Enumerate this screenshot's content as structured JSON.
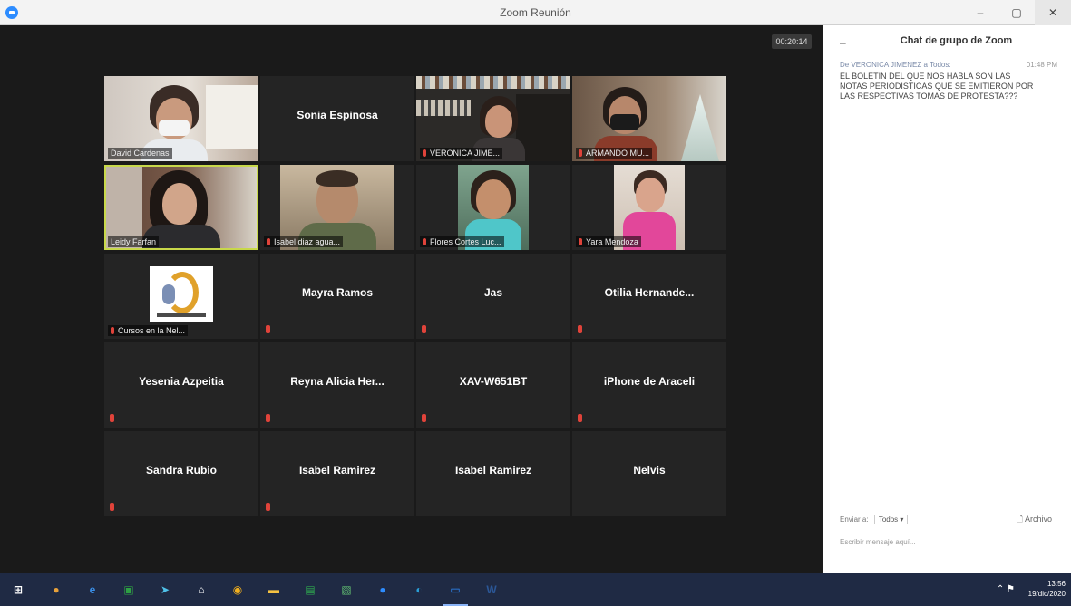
{
  "window": {
    "title": "Zoom Reunión",
    "controls": [
      "–",
      "▢",
      "✕"
    ]
  },
  "meeting": {
    "timer": "00:20:14",
    "tiles": [
      {
        "id": "david",
        "type": "video",
        "label": "David Cardenas",
        "muted": false,
        "active": false
      },
      {
        "id": "sonia",
        "type": "name",
        "name": "Sonia Espinosa",
        "muted": false,
        "active": false
      },
      {
        "id": "veronica",
        "type": "video",
        "label": "VERONICA JIME...",
        "muted": true,
        "active": false
      },
      {
        "id": "armando",
        "type": "video",
        "label": "ARMANDO MU...",
        "muted": true,
        "active": false
      },
      {
        "id": "leidy",
        "type": "video",
        "label": "Leidy Farfan",
        "muted": false,
        "active": true
      },
      {
        "id": "isabel-diaz",
        "type": "video",
        "label": "Isabel diaz agua...",
        "muted": true,
        "active": false
      },
      {
        "id": "flores",
        "type": "video",
        "label": "Flores Cortes Luc...",
        "muted": true,
        "active": false
      },
      {
        "id": "yara",
        "type": "video",
        "label": "Yara Mendoza",
        "muted": true,
        "active": false
      },
      {
        "id": "cursos",
        "type": "logo",
        "label": "Cursos en la Nel...",
        "muted": true,
        "active": false
      },
      {
        "id": "mayra",
        "type": "name",
        "name": "Mayra Ramos",
        "muted": true,
        "active": false
      },
      {
        "id": "jas",
        "type": "name",
        "name": "Jas",
        "muted": true,
        "active": false
      },
      {
        "id": "otilia",
        "type": "name",
        "name": "Otilia Hernande...",
        "muted": true,
        "active": false
      },
      {
        "id": "yesenia",
        "type": "name",
        "name": "Yesenia Azpeitia",
        "muted": true,
        "active": false
      },
      {
        "id": "reyna",
        "type": "name",
        "name": "Reyna Alicia Her...",
        "muted": true,
        "active": false
      },
      {
        "id": "xav",
        "type": "name",
        "name": "XAV-W651BT",
        "muted": true,
        "active": false
      },
      {
        "id": "iphone",
        "type": "name",
        "name": "iPhone de Araceli",
        "muted": true,
        "active": false
      },
      {
        "id": "sandra",
        "type": "name",
        "name": "Sandra Rubio",
        "muted": true,
        "active": false
      },
      {
        "id": "isabel1",
        "type": "name",
        "name": "Isabel Ramirez",
        "muted": true,
        "active": false
      },
      {
        "id": "isabel2",
        "type": "name",
        "name": "Isabel Ramirez",
        "muted": false,
        "active": false
      },
      {
        "id": "nelvis",
        "type": "name",
        "name": "Nelvis",
        "muted": false,
        "active": false
      }
    ]
  },
  "chat": {
    "title": "Chat de grupo de Zoom",
    "collapse_icon": "–",
    "sender": "De VERONICA JIMENEZ a Todos:",
    "time": "01:48 PM",
    "message": "EL BOLETIN DEL QUE NOS HABLA SON LAS NOTAS PERIODISTICAS QUE SE EMITIERON POR LAS RESPECTIVAS TOMAS DE PROTESTA???",
    "to_label": "Enviar a:",
    "to_value": "Todos ▾",
    "file_label": "Archivo",
    "input_placeholder": "Escribir mensaje aquí..."
  },
  "taskbar": {
    "apps": [
      {
        "name": "windows-start-icon",
        "glyph": "⊞",
        "color": "#ffffff"
      },
      {
        "name": "ie-old-icon",
        "glyph": "●",
        "color": "#e8a13a"
      },
      {
        "name": "edge-legacy-icon",
        "glyph": "e",
        "color": "#3a8ee6"
      },
      {
        "name": "store-icon",
        "glyph": "▣",
        "color": "#2ea043"
      },
      {
        "name": "arrow-app-icon",
        "glyph": "➤",
        "color": "#4fc1e9"
      },
      {
        "name": "home-icon",
        "glyph": "⌂",
        "color": "#ffffff"
      },
      {
        "name": "chrome-icon",
        "glyph": "◉",
        "color": "#f2b01e"
      },
      {
        "name": "file-explorer-icon",
        "glyph": "▬",
        "color": "#f5c242"
      },
      {
        "name": "sheets-icon",
        "glyph": "▤",
        "color": "#2fa84f"
      },
      {
        "name": "photos-icon",
        "glyph": "▧",
        "color": "#5fb970"
      },
      {
        "name": "meet-icon",
        "glyph": "●",
        "color": "#2d8cff"
      },
      {
        "name": "edge-icon",
        "glyph": "◐",
        "color": "#2aa0d8"
      },
      {
        "name": "zoom-icon",
        "glyph": "▭",
        "color": "#2d8cff"
      },
      {
        "name": "word-icon",
        "glyph": "W",
        "color": "#2b5797"
      }
    ],
    "tray_icons": "⌃  ⚑",
    "time": "13:56",
    "date": "19/dic/2020"
  }
}
